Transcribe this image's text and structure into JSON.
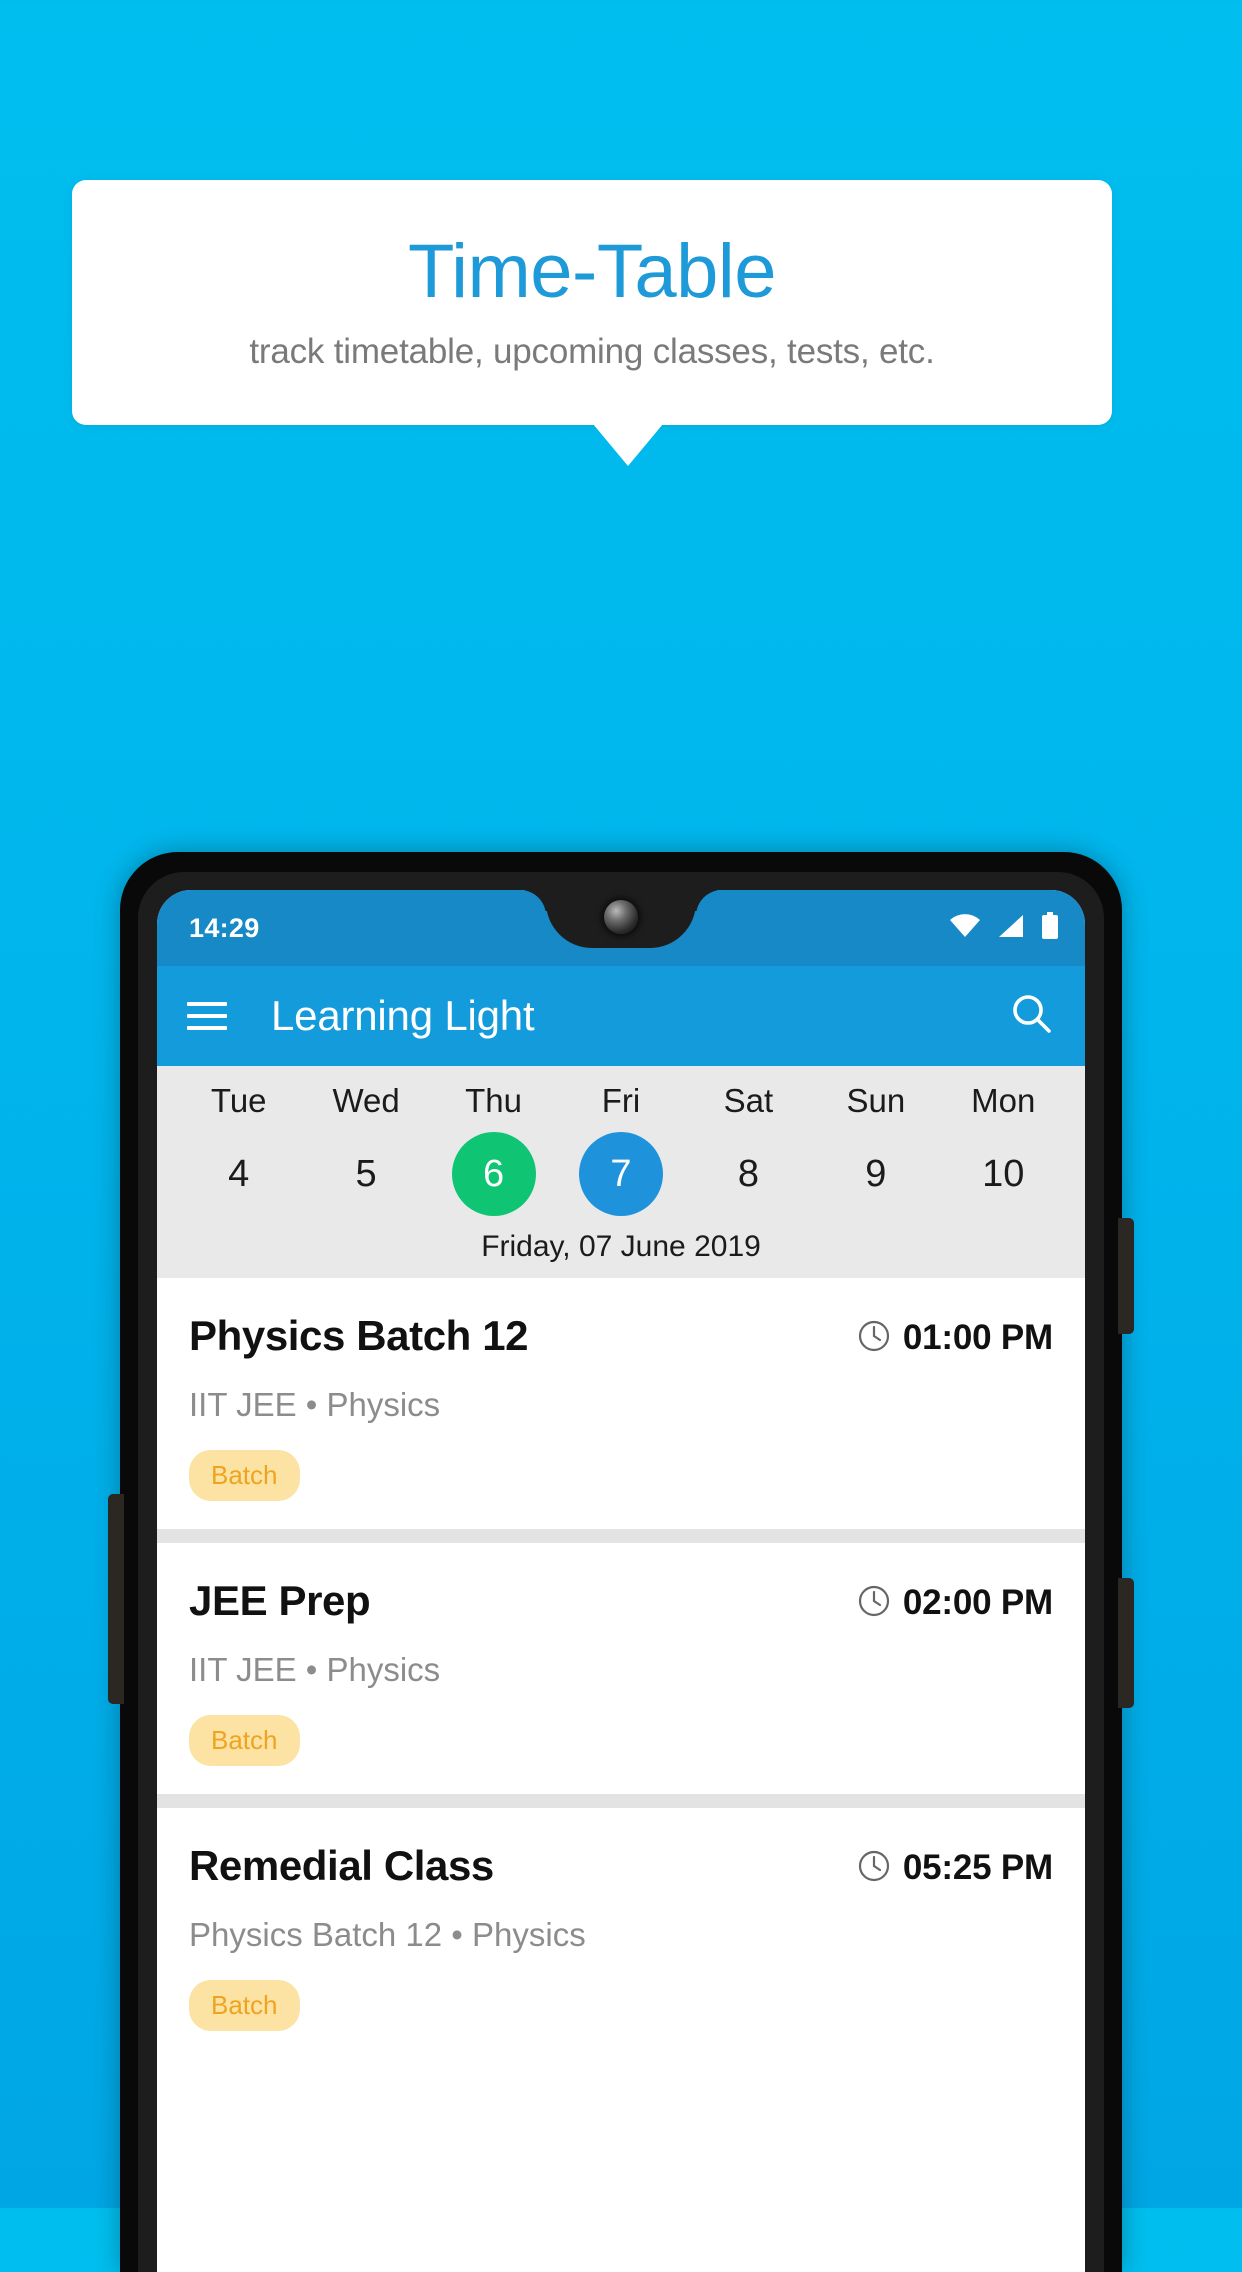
{
  "promo": {
    "title": "Time-Table",
    "subtitle": "track timetable, upcoming classes, tests, etc."
  },
  "colors": {
    "background_top": "#00BFEF",
    "background_bottom": "#00A6E4",
    "promo_title": "#1E9AD8",
    "app_bar": "#139BDC",
    "status_bar": "#1689C6",
    "today_circle": "#0FC472",
    "selected_circle": "#1E93DC",
    "chip_background": "#FCE3A4",
    "chip_text": "#EFA420"
  },
  "phone": {
    "status_bar": {
      "time": "14:29",
      "icons": [
        "wifi-icon",
        "signal-icon",
        "battery-icon"
      ]
    },
    "app_bar": {
      "menu_icon": "hamburger-menu-icon",
      "title": "Learning Light",
      "search_icon": "search-icon"
    },
    "date_strip": {
      "days": [
        {
          "day": "Tue",
          "num": "4",
          "state": "normal"
        },
        {
          "day": "Wed",
          "num": "5",
          "state": "normal"
        },
        {
          "day": "Thu",
          "num": "6",
          "state": "today"
        },
        {
          "day": "Fri",
          "num": "7",
          "state": "selected"
        },
        {
          "day": "Sat",
          "num": "8",
          "state": "normal"
        },
        {
          "day": "Sun",
          "num": "9",
          "state": "normal"
        },
        {
          "day": "Mon",
          "num": "10",
          "state": "normal"
        }
      ],
      "selected_date_label": "Friday, 07 June 2019"
    },
    "classes": [
      {
        "title": "Physics Batch 12",
        "time": "01:00 PM",
        "subtitle": "IIT JEE • Physics",
        "chip": "Batch",
        "clock_icon": "clock-icon"
      },
      {
        "title": "JEE Prep",
        "time": "02:00 PM",
        "subtitle": "IIT JEE • Physics",
        "chip": "Batch",
        "clock_icon": "clock-icon"
      },
      {
        "title": "Remedial Class",
        "time": "05:25 PM",
        "subtitle": "Physics Batch 12 • Physics",
        "chip": "Batch",
        "clock_icon": "clock-icon"
      }
    ]
  }
}
